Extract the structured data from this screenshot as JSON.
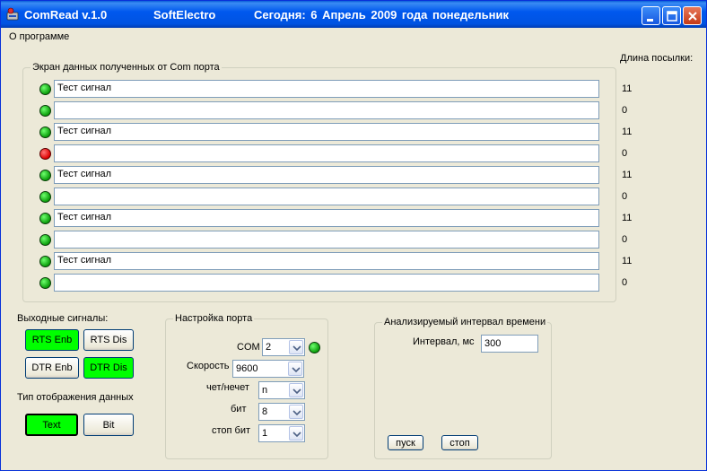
{
  "window": {
    "app_title": "ComRead v.1.0",
    "company": "SoftElectro",
    "date_text": "Сегодня: 6 Апрель 2009 года понедельник"
  },
  "menu": {
    "about": "О программе"
  },
  "data_screen": {
    "title": "Экран данных полученных от Com порта",
    "length_header": "Длина посылки:",
    "rows": [
      {
        "text": "Тест сигнал",
        "length": "11",
        "led": "green"
      },
      {
        "text": "",
        "length": "0",
        "led": "green"
      },
      {
        "text": "Тест сигнал",
        "length": "11",
        "led": "green"
      },
      {
        "text": "",
        "length": "0",
        "led": "red"
      },
      {
        "text": "Тест сигнал",
        "length": "11",
        "led": "green"
      },
      {
        "text": "",
        "length": "0",
        "led": "green"
      },
      {
        "text": "Тест сигнал",
        "length": "11",
        "led": "green"
      },
      {
        "text": "",
        "length": "0",
        "led": "green"
      },
      {
        "text": "Тест сигнал",
        "length": "11",
        "led": "green"
      },
      {
        "text": "",
        "length": "0",
        "led": "green"
      }
    ]
  },
  "output_signals": {
    "title": "Выходные сигналы:",
    "rts_enb": "RTS Enb",
    "rts_dis": "RTS Dis",
    "dtr_enb": "DTR Enb",
    "dtr_dis": "DTR Dis",
    "display_type_title": "Тип отображения данных",
    "text_btn": "Text",
    "bit_btn": "Bit"
  },
  "port_settings": {
    "title": "Настройка порта",
    "com_label": "COM",
    "com_value": "2",
    "speed_label": "Скорость",
    "speed_value": "9600",
    "parity_label": "чет/нечет",
    "parity_value": "n",
    "bits_label": "бит",
    "bits_value": "8",
    "stop_label": "стоп бит",
    "stop_value": "1"
  },
  "interval": {
    "title": "Анализируемый интервал времени",
    "label": "Интервал, мс",
    "value": "300",
    "start_btn": "пуск",
    "stop_btn": "стоп"
  },
  "colors": {
    "active_button": "#00ff00",
    "led_green": "#0b9d0b",
    "led_red": "#dd0000",
    "title_bar": "#0053e1"
  }
}
